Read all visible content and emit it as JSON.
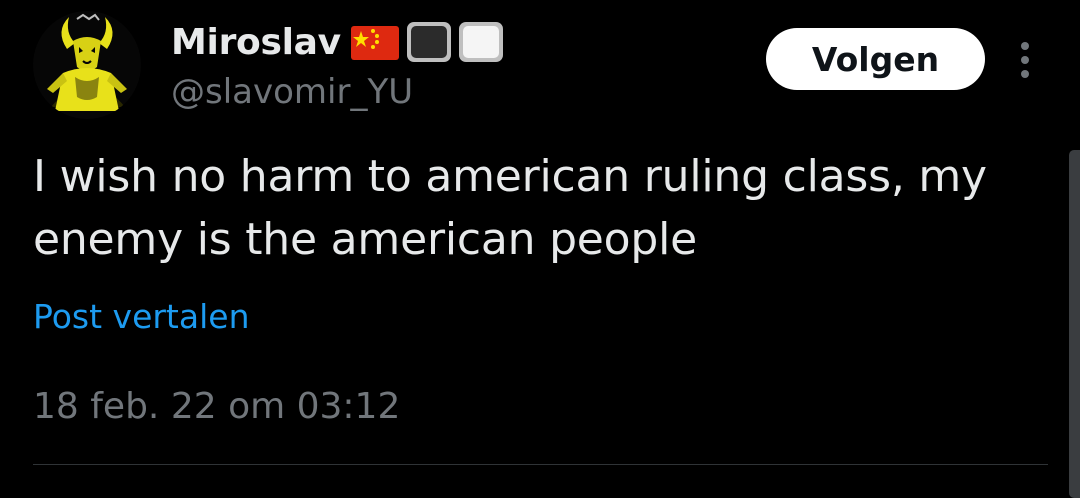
{
  "tweet": {
    "author": {
      "display_name": "Miroslav",
      "handle": "@slavomir_YU",
      "name_emojis": [
        "flag-china-emoji",
        "black-square-emoji",
        "white-square-emoji"
      ],
      "avatar_icon": "yellow-goat-figure-avatar"
    },
    "follow_label": "Volgen",
    "more_icon": "more-vertical-icon",
    "text": "I wish no harm to american ruling class, my enemy is the american people",
    "translate_label": "Post vertalen",
    "timestamp": "18 feb. 22 om 03:12"
  },
  "colors": {
    "background": "#000000",
    "primary_text": "#e7e9ea",
    "secondary_text": "#71767b",
    "link": "#1d9bf0",
    "button_bg": "#ffffff",
    "button_text": "#0f1419",
    "divider": "#2f3336",
    "avatar_accent": "#e8e11a"
  }
}
